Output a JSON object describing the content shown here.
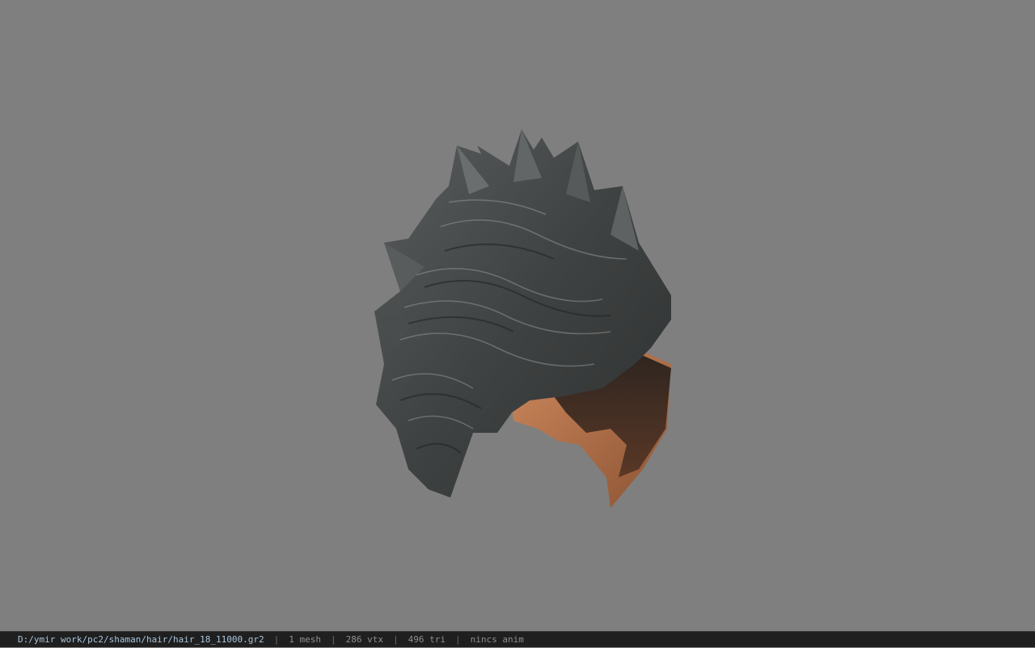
{
  "viewer": {
    "background_color": "#7f7f7f",
    "model_name_icon": "hair-model-icon"
  },
  "statusbar": {
    "path": "D:/ymir work/pc2/shaman/hair/hair_18_11000.gr2",
    "separator": "|",
    "mesh_count": "1 mesh",
    "vertex_count": "286 vtx",
    "triangle_count": "496 tri",
    "anim": "nincs anim"
  }
}
